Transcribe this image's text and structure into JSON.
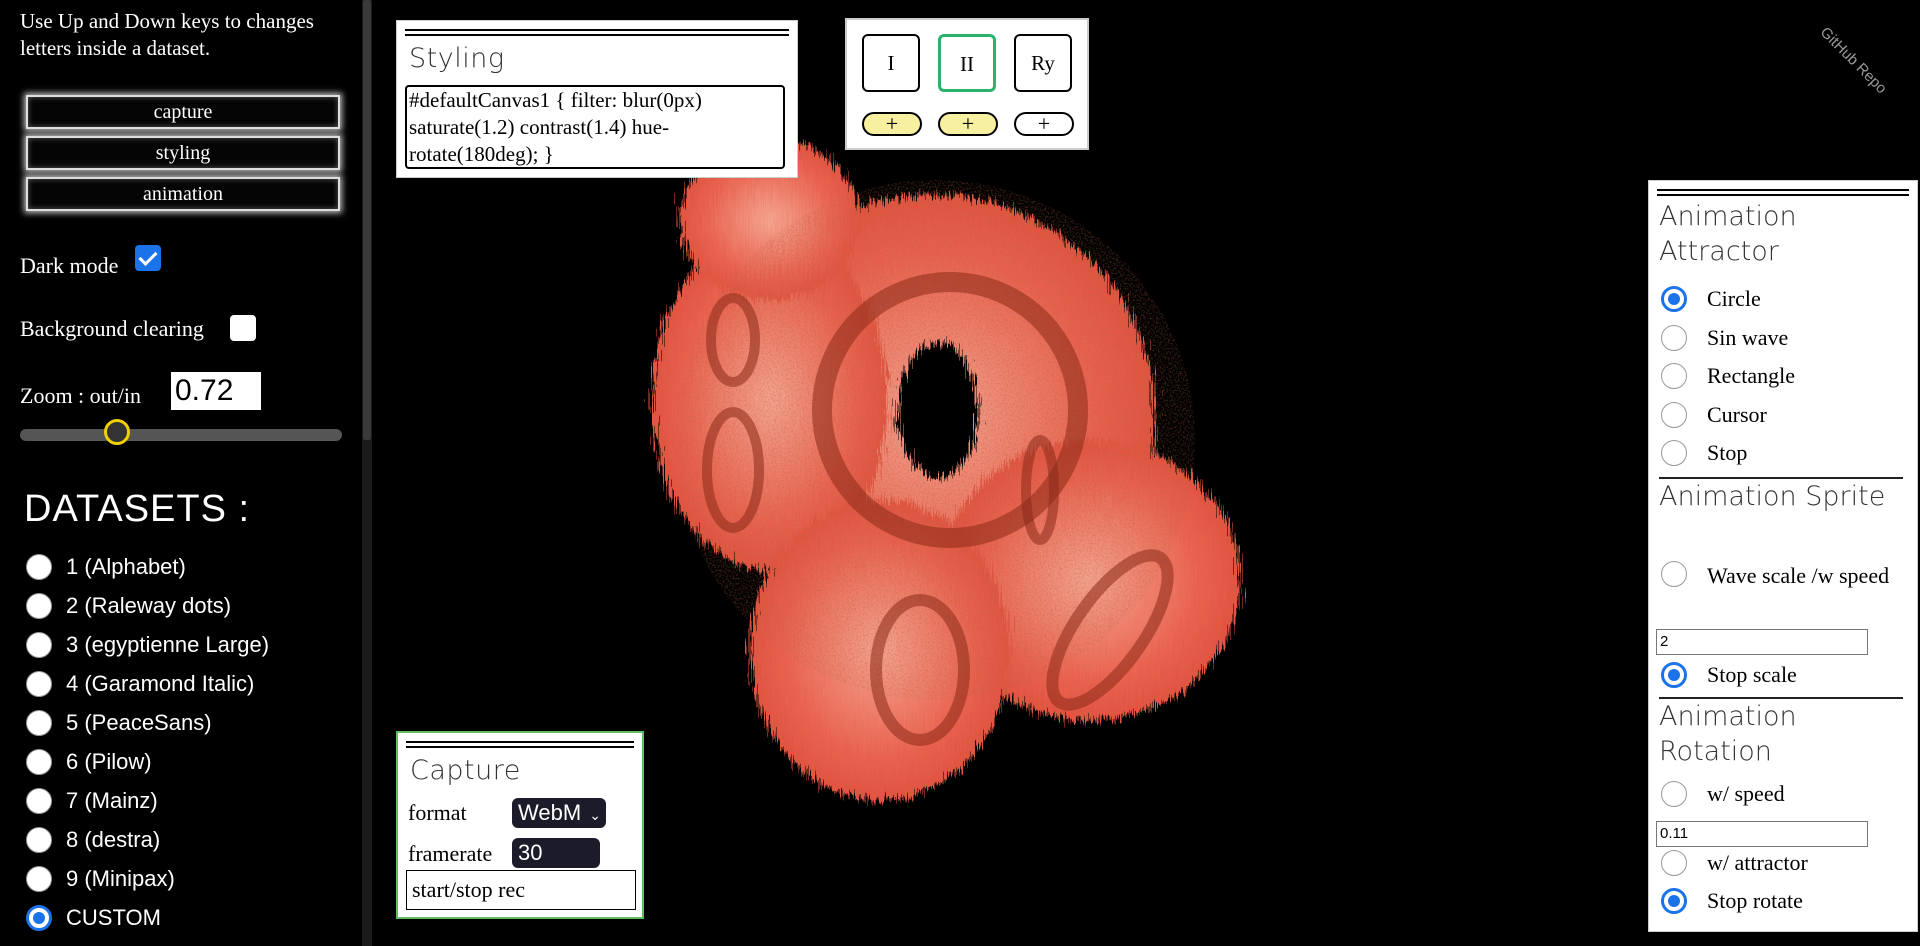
{
  "sidebar": {
    "help_text": "Use Up and Down keys to changes letters inside a dataset.",
    "buttons": [
      {
        "label": "capture"
      },
      {
        "label": "styling"
      },
      {
        "label": "animation"
      }
    ],
    "dark_mode": {
      "label": "Dark mode",
      "checked": true
    },
    "background_clearing": {
      "label": "Background clearing",
      "checked": false
    },
    "zoom": {
      "label": "Zoom : out/in",
      "value": "0.72",
      "slider_fraction": 0.3
    },
    "datasets_title": "DATASETS :",
    "datasets": [
      {
        "label": "1 (Alphabet)",
        "selected": false
      },
      {
        "label": "2 (Raleway dots)",
        "selected": false
      },
      {
        "label": "3 (egyptienne Large)",
        "selected": false
      },
      {
        "label": "4 (Garamond Italic)",
        "selected": false
      },
      {
        "label": "5 (PeaceSans)",
        "selected": false
      },
      {
        "label": "6 (Pilow)",
        "selected": false
      },
      {
        "label": "7 (Mainz)",
        "selected": false
      },
      {
        "label": "8 (destra)",
        "selected": false
      },
      {
        "label": "9 (Minipax)",
        "selected": false
      },
      {
        "label": "CUSTOM",
        "selected": true
      }
    ]
  },
  "styling": {
    "title": "Styling",
    "css_text": "#defaultCanvas1 { filter: blur(0px) saturate(1.2) contrast(1.4) hue-rotate(180deg); }"
  },
  "dataset_buttons": {
    "items": [
      {
        "label": "I",
        "selected": false
      },
      {
        "label": "II",
        "selected": true
      },
      {
        "label": "Ry",
        "selected": false
      }
    ],
    "plus_label": "+"
  },
  "capture": {
    "title": "Capture",
    "format_label": "format",
    "format_value": "WebM",
    "framerate_label": "framerate",
    "framerate_value": "30",
    "rec_label": "start/stop rec"
  },
  "animation": {
    "attractor_title": "Animation Attractor",
    "attractor_options": [
      {
        "label": "Circle",
        "selected": true
      },
      {
        "label": "Sin wave",
        "selected": false
      },
      {
        "label": "Rectangle",
        "selected": false
      },
      {
        "label": "Cursor",
        "selected": false
      },
      {
        "label": "Stop",
        "selected": false
      }
    ],
    "sprite_title": "Animation Sprite",
    "wave_scale_label": "Wave scale /w speed",
    "wave_scale_selected": false,
    "wave_scale_value": "2",
    "stop_scale_label": "Stop scale",
    "stop_scale_selected": true,
    "rotation_title": "Animation Rotation",
    "w_speed_label": "w/ speed",
    "w_speed_selected": false,
    "w_speed_value": "0.11",
    "w_attractor_label": "w/ attractor",
    "w_attractor_selected": false,
    "stop_rotate_label": "Stop rotate",
    "stop_rotate_selected": true
  },
  "github_ribbon": "GitHub Repo",
  "colors": {
    "art_base": "#e8624e",
    "art_light": "#f4a38f",
    "art_dark": "#8a2a18",
    "accent_blue": "#1a73e8",
    "selected_green": "#2bb36b",
    "slider_thumb": "#f0d000"
  }
}
